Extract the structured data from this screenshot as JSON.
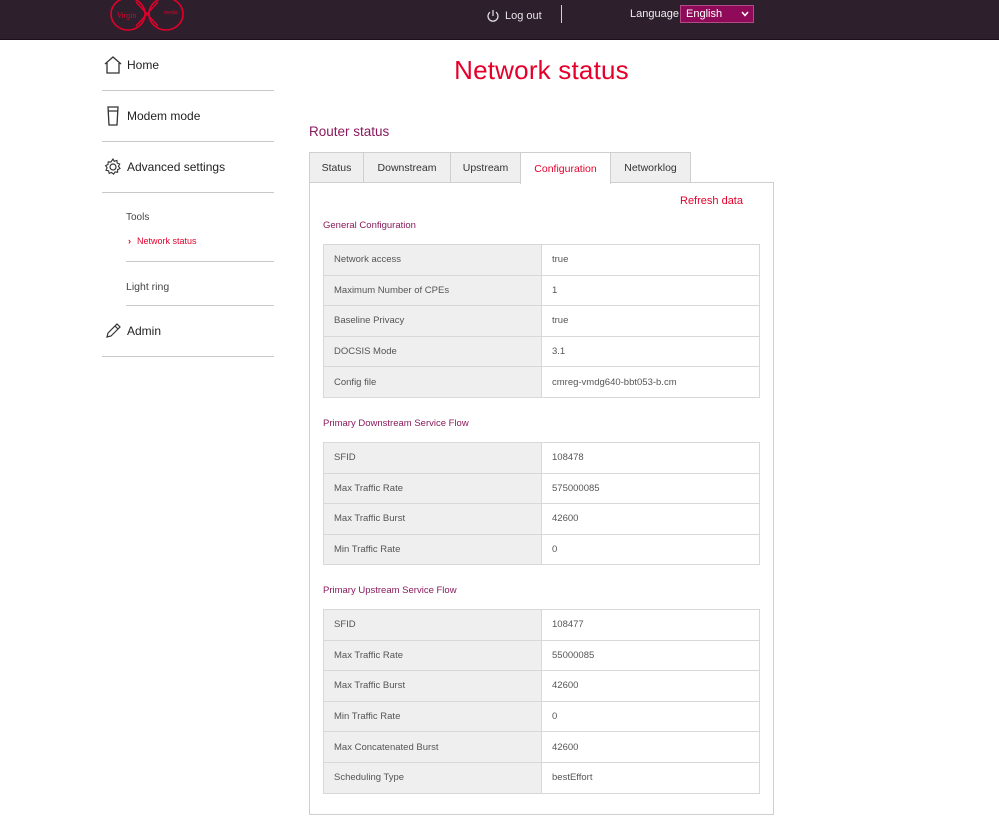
{
  "header": {
    "logo_text": "Virgin media",
    "logout_label": "Log out",
    "language_label": "Language",
    "language_value": "English"
  },
  "sidebar": {
    "home": "Home",
    "modem_mode": "Modem mode",
    "advanced_settings": "Advanced settings",
    "tools": "Tools",
    "network_status": "Network status",
    "light_ring": "Light ring",
    "admin": "Admin"
  },
  "main": {
    "title": "Network status",
    "section": "Router status",
    "tabs": [
      "Status",
      "Downstream",
      "Upstream",
      "Configuration",
      "Networklog"
    ],
    "active_tab": "Configuration",
    "refresh": "Refresh data",
    "general": {
      "title": "General Configuration",
      "rows": [
        {
          "k": "Network access",
          "v": "true"
        },
        {
          "k": "Maximum Number of CPEs",
          "v": "1"
        },
        {
          "k": "Baseline Privacy",
          "v": "true"
        },
        {
          "k": "DOCSIS Mode",
          "v": "3.1"
        },
        {
          "k": "Config file",
          "v": "cmreg-vmdg640-bbt053-b.cm"
        }
      ]
    },
    "downstream": {
      "title": "Primary Downstream Service Flow",
      "rows": [
        {
          "k": "SFID",
          "v": "108478"
        },
        {
          "k": "Max Traffic Rate",
          "v": "575000085"
        },
        {
          "k": "Max Traffic Burst",
          "v": "42600"
        },
        {
          "k": "Min Traffic Rate",
          "v": "0"
        }
      ]
    },
    "upstream": {
      "title": "Primary Upstream Service Flow",
      "rows": [
        {
          "k": "SFID",
          "v": "108477"
        },
        {
          "k": "Max Traffic Rate",
          "v": "55000085"
        },
        {
          "k": "Max Traffic Burst",
          "v": "42600"
        },
        {
          "k": "Min Traffic Rate",
          "v": "0"
        },
        {
          "k": "Max Concatenated Burst",
          "v": "42600"
        },
        {
          "k": "Scheduling Type",
          "v": "bestEffort"
        }
      ]
    }
  },
  "colors": {
    "header_bg": "#2d1f2c",
    "accent_red": "#e4002b",
    "accent_purple": "#8a1a5c",
    "select_bg": "#8f0b59"
  }
}
